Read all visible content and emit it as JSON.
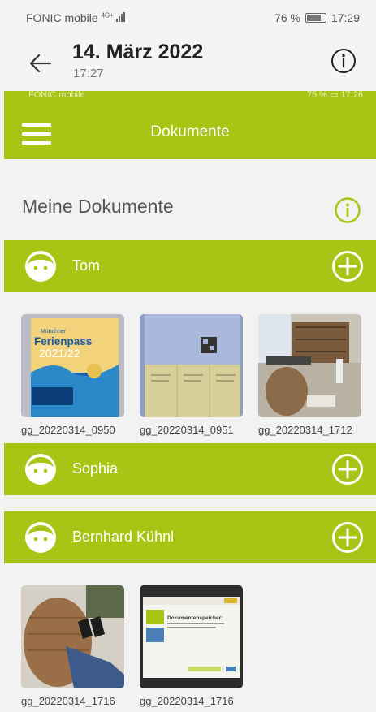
{
  "status_outer": {
    "carrier": "FONIC mobile",
    "network": "4G+",
    "battery": "76 %",
    "time": "17:29"
  },
  "gallery": {
    "title": "14. März 2022",
    "time": "17:27"
  },
  "inner_status": {
    "carrier": "FONIC mobile",
    "battery": "75 %",
    "time": "17:26"
  },
  "app": {
    "title": "Dokumente",
    "section_title": "Meine Dokumente"
  },
  "colors": {
    "accent": "#a8c515",
    "background": "#f2f2f2"
  },
  "people": [
    {
      "name": "Tom",
      "documents": [
        "gg_20220314_0950",
        "gg_20220314_0951",
        "gg_20220314_1712"
      ]
    },
    {
      "name": "Sophia",
      "documents": []
    },
    {
      "name": "Bernhard Kühnl",
      "documents": [
        "gg_20220314_1716",
        "gg_20220314_1716"
      ]
    }
  ],
  "thumb_text": {
    "ferien_small": "Münchner",
    "ferien_big": "Ferienpass",
    "ferien_year": "2021/22",
    "doc_heading": "Dokumentenspeicher:"
  }
}
